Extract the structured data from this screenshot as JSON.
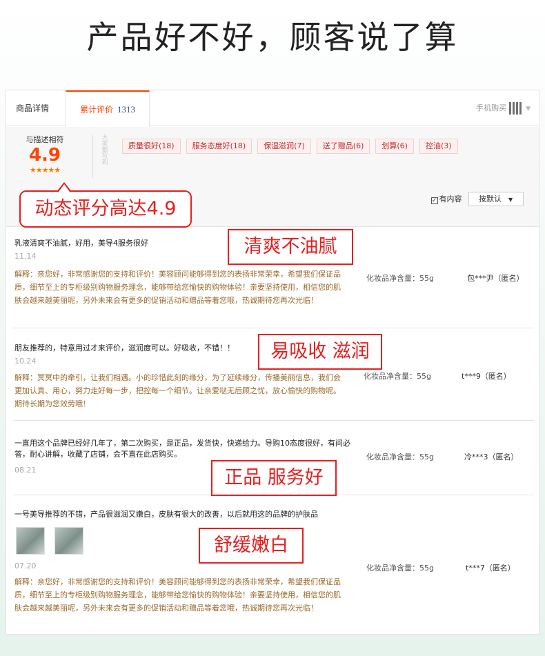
{
  "headline": "产品好不好，顾客说了算",
  "tabs": {
    "detail": "商品详情",
    "review_label": "累计评价",
    "review_count": "1313",
    "mobile_buy": "手机购买"
  },
  "rating": {
    "label": "与描述相符",
    "score": "4.9",
    "stars": "★★★★★"
  },
  "impression_title": "大家都写到",
  "tags": [
    "质量很好(18)",
    "服务态度好(18)",
    "保湿滋润(7)",
    "送了赠品(6)",
    "划算(6)",
    "控油(3)"
  ],
  "filter": {
    "has_content": "有内容",
    "sort": "按默认"
  },
  "callouts": {
    "score": "动态评分高达4.9",
    "r1": "清爽不油腻",
    "r2": "易吸收 滋润",
    "r3": "正品 服务好",
    "r4": "舒缓嫩白"
  },
  "reviews": [
    {
      "text": "乳液清爽不油腻，好用，美导4服务很好",
      "date": "11.14",
      "reply": "解释：亲您好，非常感谢您的支持和评价！美容顾问能够得到您的表扬非常荣幸，希望我们保证品质，细节至上的专柜级别购物服务理念，能够带给您愉快的购物体验！亲要坚持使用，相信您的肌肤会越来越美丽呢，另外未来会有更多的促销活动和赠品等着您哦，热诚期待您再次光临！",
      "spec_key": "化妆品净含量：",
      "spec_val": "55g",
      "user": "包***尹（匿名）"
    },
    {
      "text": "朋友推荐的，特意用过才来评价，滋润度可以。好吸收，不错！！",
      "date": "10.24",
      "reply": "解释：冥冥中的牵引，让我们相遇。小的珍惜此刻的缘分，为了延续缘分，传播美丽信息，我们会更加认真、用心，努力走好每一步，把控每一个细节。让亲爱哒无后顾之忧，放心愉快的购物呢。期待长期为您效劳哦！",
      "spec_key": "化妆品净含量：",
      "spec_val": "55g",
      "user": "t***9（匿名）"
    },
    {
      "text": "一直用这个品牌已经好几年了，第二次购买，是正品，发货快，快递给力。导购10态度很好，有问必答，耐心讲解，收藏了店铺，会不直在此店购买。",
      "date": "08.21",
      "spec_key": "化妆品净含量：",
      "spec_val": "55g",
      "user": "冷***3（匿名）"
    },
    {
      "text": "一号美导推荐的不错，产品很滋润又嫩白，皮肤有很大的改善，以后就用这的品牌的护肤品",
      "date": "07.20",
      "reply": "解释：亲您好，非常感谢您的支持和评价！美容顾问能够得到您的表扬非常荣幸，希望我们保证品质，细节至上的专柜级别购物服务理念，能够带给您愉快的购物体验！亲要坚持使用，相信您的肌肤会越来越美丽呢，另外未来会有更多的促销活动和赠品等着您哦，热诚期待您再次光临！",
      "spec_key": "化妆品净含量：",
      "spec_val": "55g",
      "user": "t***7（匿名）"
    }
  ]
}
